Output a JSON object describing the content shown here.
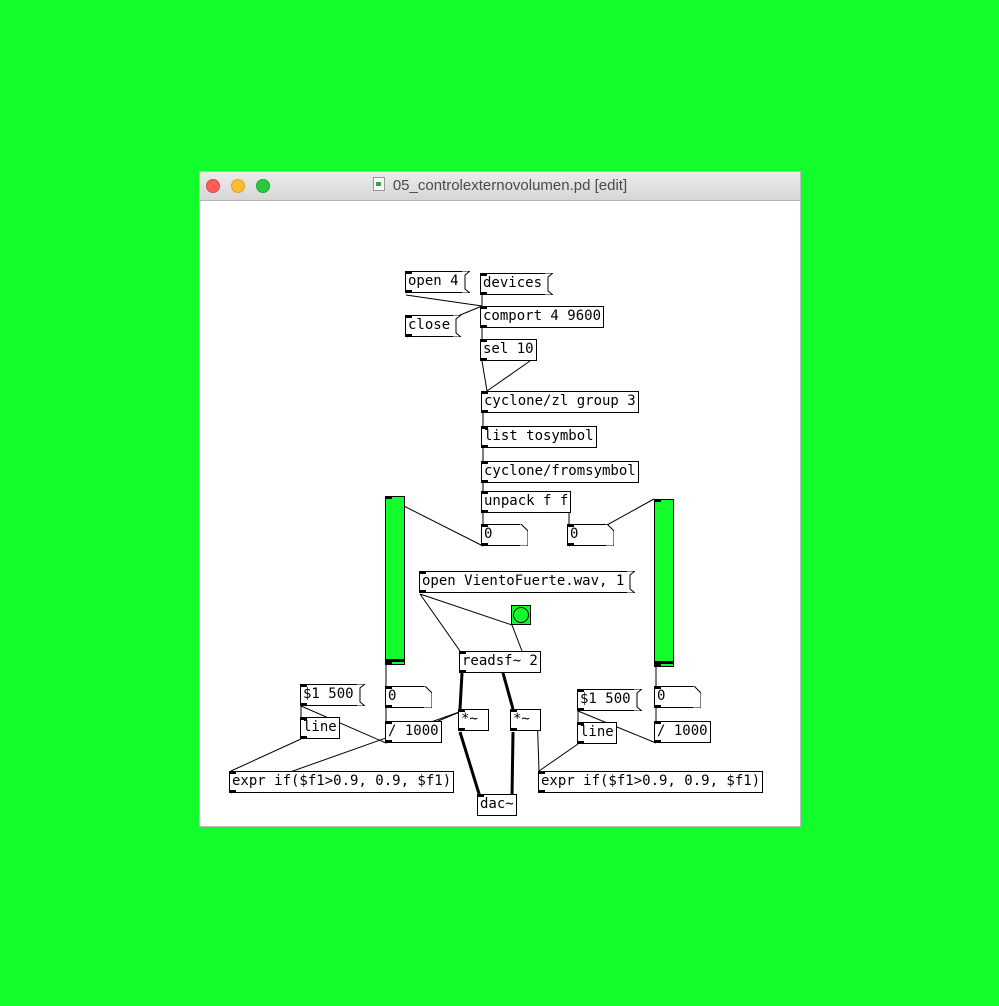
{
  "window": {
    "title": "05_controlexternovolumen.pd [edit]",
    "file_icon": "pd-file-icon"
  },
  "colors": {
    "background": "#13fc2b",
    "slider_fill": "#13fc2b",
    "canvas": "#ffffff"
  },
  "patch": {
    "msg_open4": "open 4",
    "msg_devices": "devices",
    "msg_close": "close",
    "obj_comport": "comport 4 9600",
    "obj_sel": "sel 10",
    "obj_zl": "cyclone/zl group 3",
    "obj_tosymbol": "list tosymbol",
    "obj_fromsymbol": "cyclone/fromsymbol",
    "obj_unpack": "unpack f f",
    "num_left": "0",
    "num_right": "0",
    "msg_open_wav": "open VientoFuerte.wav, 1",
    "obj_readsf": "readsf~ 2",
    "num_left_scale": "0",
    "num_right_scale": "0",
    "msg_ramp_left": "$1 500",
    "msg_ramp_right": "$1 500",
    "obj_line_left": "line",
    "obj_line_right": "line",
    "obj_div_left": "/ 1000",
    "obj_div_right": "/ 1000",
    "obj_mul_left": "*~",
    "obj_mul_right": "*~",
    "obj_expr_left": "expr if($f1>0.9, 0.9, $f1)",
    "obj_expr_right": "expr if($f1>0.9, 0.9, $f1)",
    "obj_dac": "dac~",
    "slider_left_value": 0.0,
    "slider_right_value": 0.0
  }
}
